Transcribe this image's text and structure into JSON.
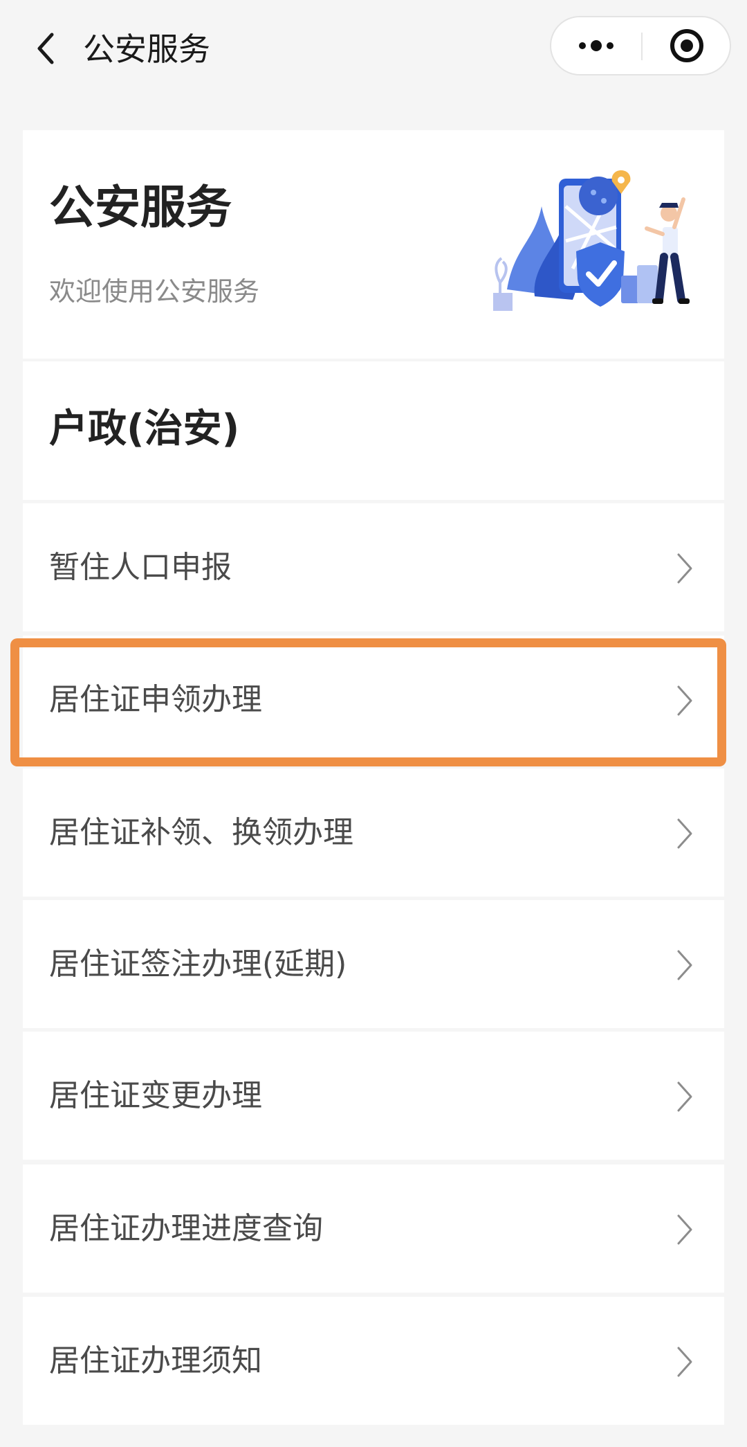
{
  "navbar": {
    "title": "公安服务",
    "back_icon": "chevron-left-icon",
    "more_icon": "more-dots-icon",
    "close_icon": "target-close-icon"
  },
  "hero": {
    "title": "公安服务",
    "subtitle": "欢迎使用公安服务",
    "illustration": "police-phone-map-shield-illustration"
  },
  "section": {
    "title": "户政(治安)"
  },
  "items": [
    {
      "label": "暂住人口申报"
    },
    {
      "label": "居住证申领办理"
    },
    {
      "label": "居住证补领、换领办理"
    },
    {
      "label": "居住证签注办理(延期)"
    },
    {
      "label": "居住证变更办理"
    },
    {
      "label": "居住证办理进度查询"
    },
    {
      "label": "居住证办理须知"
    }
  ],
  "highlight": {
    "target": "居住证申领办理",
    "color": "#ef8f44"
  },
  "colors": {
    "background": "#f5f5f5",
    "card": "#ffffff",
    "accent_blue": "#3f6fe0",
    "highlight_orange": "#ef8f44"
  }
}
